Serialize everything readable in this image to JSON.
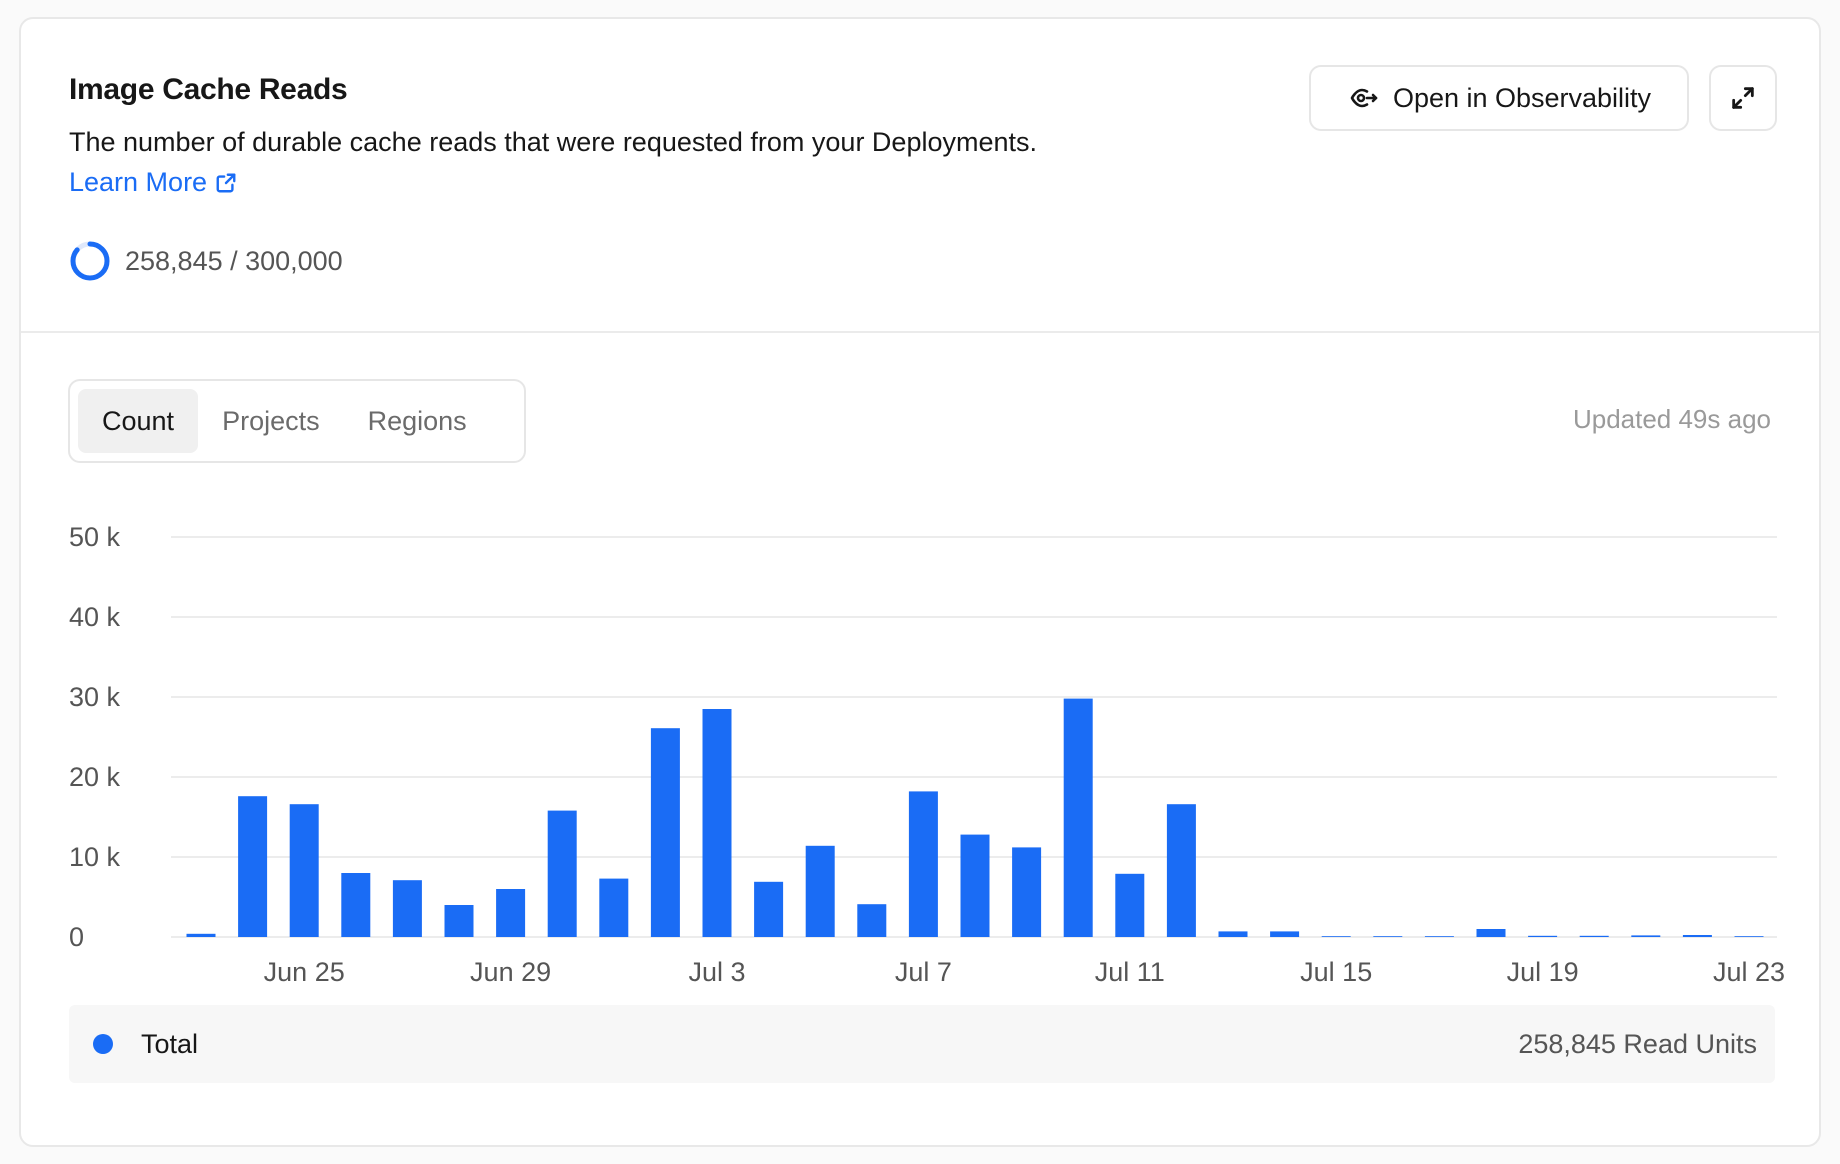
{
  "card": {
    "title": "Image Cache Reads",
    "description": "The number of durable cache reads that were requested from your Deployments.",
    "learn_more": "Learn More",
    "usage_text": "258,845 / 300,000",
    "usage_fraction": 0.8628,
    "open_button_label": "Open in Observability"
  },
  "tabs": [
    {
      "label": "Count",
      "active": true
    },
    {
      "label": "Projects",
      "active": false
    },
    {
      "label": "Regions",
      "active": false
    }
  ],
  "updated_text": "Updated 49s ago",
  "legend": {
    "label": "Total",
    "total_text": "258,845 Read Units"
  },
  "colors": {
    "accent": "#1a6cf5",
    "bar": "#1a6cf5",
    "grid": "#e5e5e5"
  },
  "chart_data": {
    "type": "bar",
    "categories": [
      "Jun 23",
      "Jun 24",
      "Jun 25",
      "Jun 26",
      "Jun 27",
      "Jun 28",
      "Jun 29",
      "Jun 30",
      "Jul 1",
      "Jul 2",
      "Jul 3",
      "Jul 4",
      "Jul 5",
      "Jul 6",
      "Jul 7",
      "Jul 8",
      "Jul 9",
      "Jul 10",
      "Jul 11",
      "Jul 12",
      "Jul 13",
      "Jul 14",
      "Jul 15",
      "Jul 16",
      "Jul 17",
      "Jul 18",
      "Jul 19",
      "Jul 20",
      "Jul 21",
      "Jul 22",
      "Jul 23"
    ],
    "values": [
      400,
      17600,
      16600,
      8000,
      7100,
      4000,
      6000,
      15800,
      7300,
      26100,
      28500,
      6900,
      11400,
      4100,
      18200,
      12800,
      11200,
      29800,
      7900,
      16600,
      700,
      700,
      100,
      50,
      100,
      1000,
      150,
      150,
      200,
      250,
      50
    ],
    "xtick_labels": [
      "Jun 25",
      "Jun 29",
      "Jul 3",
      "Jul 7",
      "Jul 11",
      "Jul 15",
      "Jul 19",
      "Jul 23"
    ],
    "ytick_labels": [
      "0",
      "10 k",
      "20 k",
      "30 k",
      "40 k",
      "50 k"
    ],
    "ylim": [
      0,
      50000
    ],
    "grid": true,
    "title": "",
    "xlabel": "",
    "ylabel": ""
  }
}
